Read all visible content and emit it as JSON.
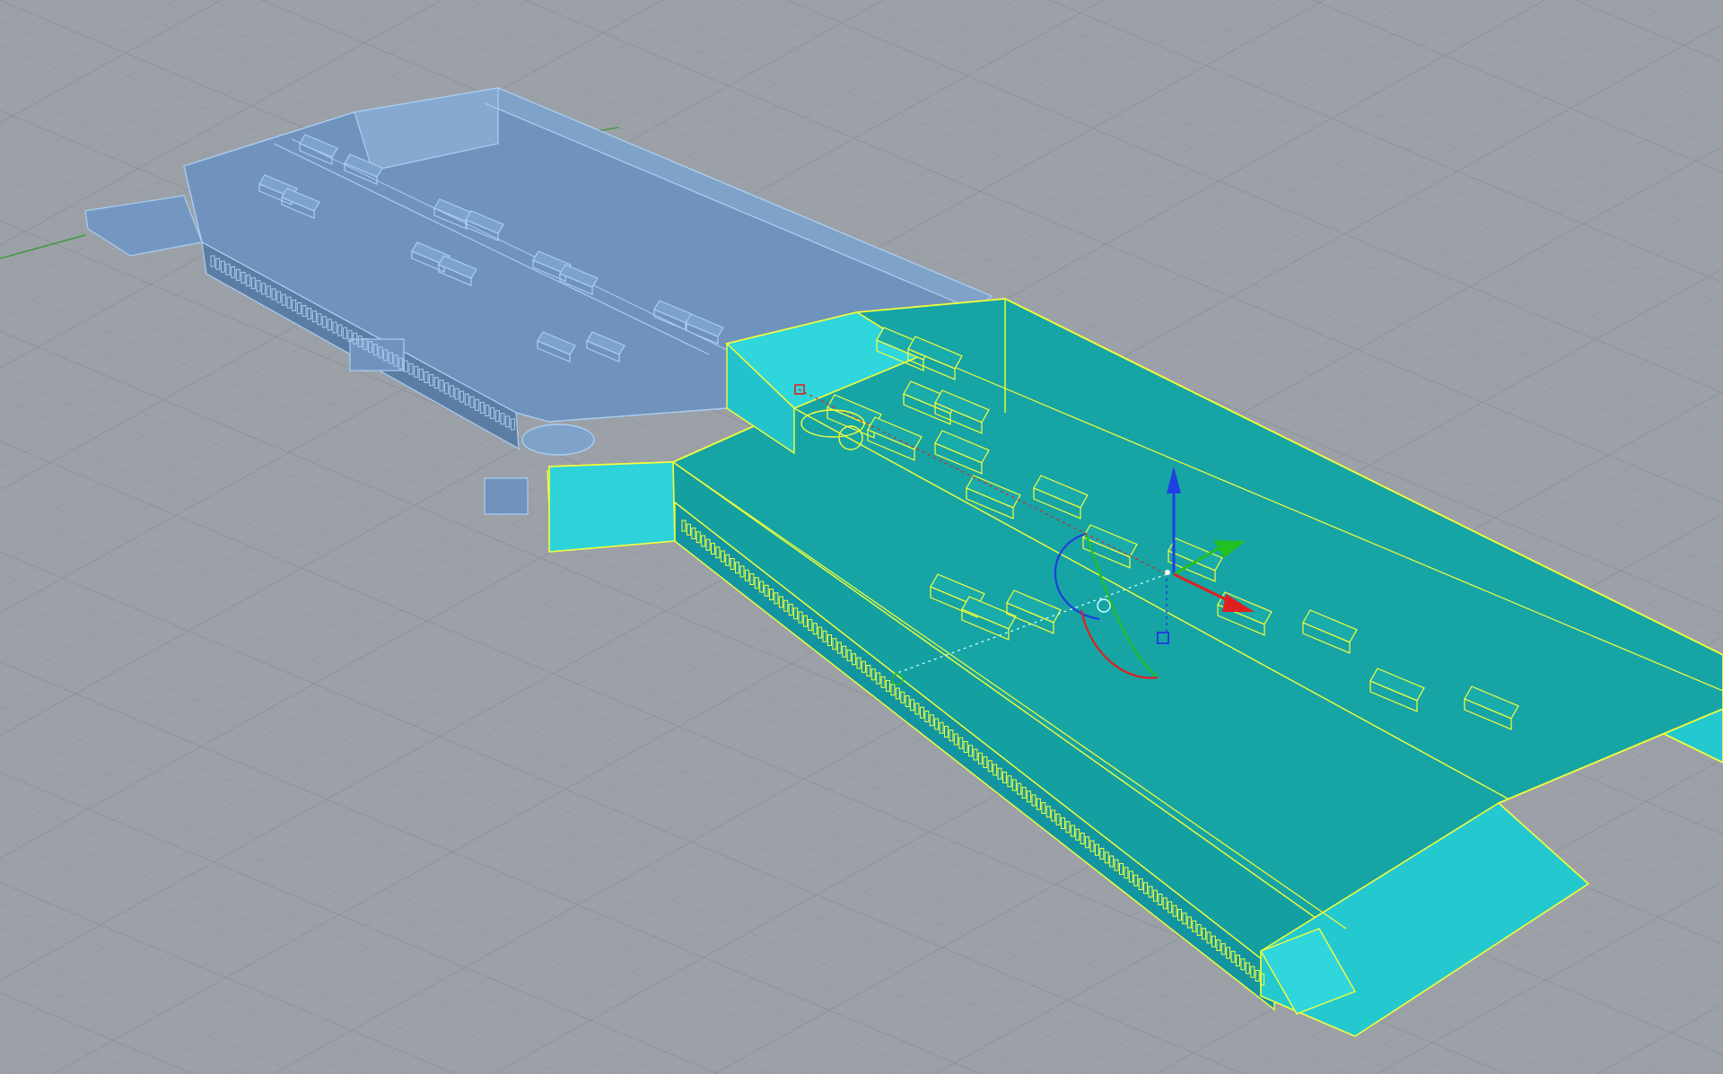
{
  "viewport": {
    "background_color": "#9ca1a8",
    "grid_minor_color": "#8f959c",
    "grid_major_color": "#858b92",
    "x_axis_color": "#b04a4a",
    "y_axis_color": "#3e9a3e"
  },
  "objects": {
    "unselected_building": {
      "fill": "#6f93bd",
      "edge": "#a9cdf2",
      "selected": false
    },
    "selected_building": {
      "fill": "#17a4a4",
      "fill_light": "#2fd6dc",
      "edge": "#f4ff3a",
      "selected": true
    }
  },
  "gizmo": {
    "x_axis_color": "#e02020",
    "y_axis_color": "#22c022",
    "z_axis_color": "#1f3fe0",
    "plane_handle_color": "#1f3fe0"
  }
}
